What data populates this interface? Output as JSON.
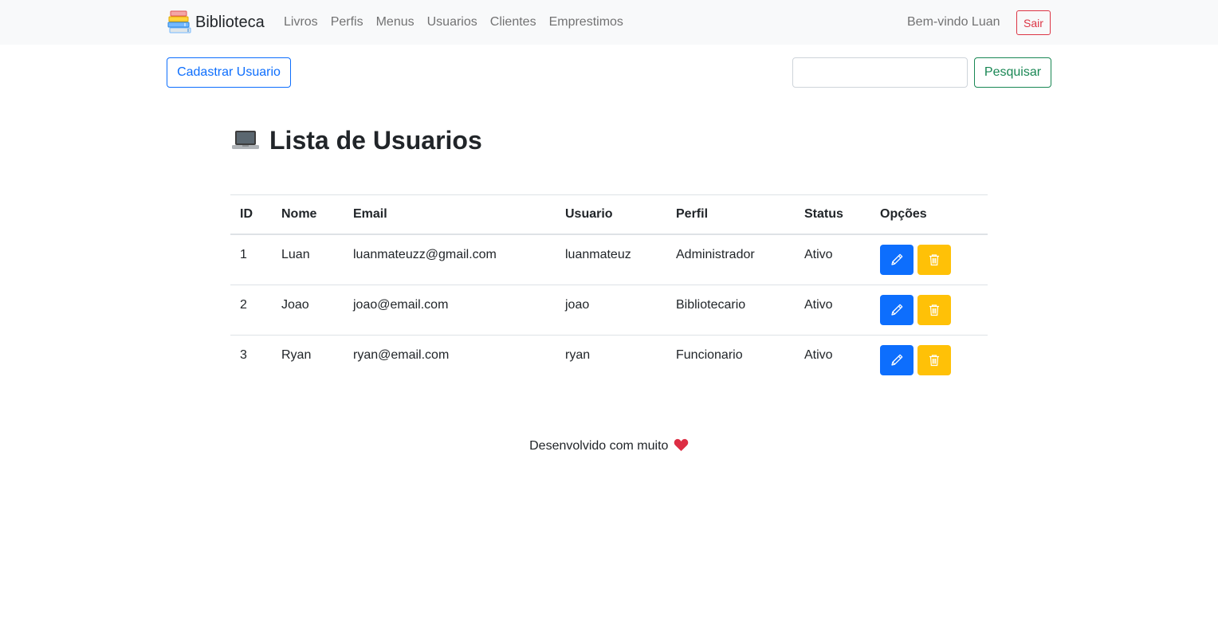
{
  "navbar": {
    "brand": "Biblioteca",
    "links": [
      "Livros",
      "Perfis",
      "Menus",
      "Usuarios",
      "Clientes",
      "Emprestimos"
    ],
    "welcome": "Bem-vindo Luan",
    "logout_label": "Sair"
  },
  "toolbar": {
    "register_label": "Cadastrar Usuario",
    "search_value": "",
    "search_label": "Pesquisar"
  },
  "page": {
    "title": "Lista de Usuarios",
    "title_icon": "laptop-icon"
  },
  "table": {
    "headers": [
      "ID",
      "Nome",
      "Email",
      "Usuario",
      "Perfil",
      "Status",
      "Opções"
    ],
    "rows": [
      [
        "1",
        "Luan",
        "luanmateuzz@gmail.com",
        "luanmateuz",
        "Administrador",
        "Ativo"
      ],
      [
        "2",
        "Joao",
        "joao@email.com",
        "joao",
        "Bibliotecario",
        "Ativo"
      ],
      [
        "3",
        "Ryan",
        "ryan@email.com",
        "ryan",
        "Funcionario",
        "Ativo"
      ]
    ],
    "row_actions": [
      "pencil-icon",
      "trash-icon"
    ]
  },
  "footer": {
    "text": "Desenvolvido com muito",
    "icon": "heart-icon"
  },
  "colors": {
    "primary": "#0d6efd",
    "warning": "#ffc107",
    "success": "#198754",
    "danger": "#dc3545",
    "navbar_bg": "#f8f9fa"
  }
}
